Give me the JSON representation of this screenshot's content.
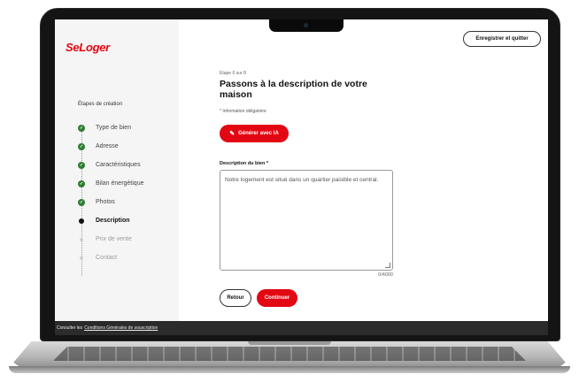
{
  "brand": {
    "logo": "SeLoger",
    "accent": "#e30613"
  },
  "header": {
    "save_label": "Enregistrer et quitter"
  },
  "sidebar": {
    "title": "Étapes de création",
    "steps": [
      {
        "label": "Type de bien",
        "state": "done"
      },
      {
        "label": "Adresse",
        "state": "done"
      },
      {
        "label": "Caractéristiques",
        "state": "done"
      },
      {
        "label": "Bilan énergétique",
        "state": "done"
      },
      {
        "label": "Photos",
        "state": "done"
      },
      {
        "label": "Description",
        "state": "current"
      },
      {
        "label": "Prix de vente",
        "state": "todo"
      },
      {
        "label": "Contact",
        "state": "todo"
      }
    ]
  },
  "main": {
    "step_count": "Étape 6 sur 8",
    "title": "Passons à la description de votre maison",
    "required_note": "* Information obligatoire",
    "ai_button": "Générer avec IA",
    "description_label": "Description du bien *",
    "description_value": "Notre logement est situé dans un quartier paisible et central.",
    "counter": "0/4000",
    "back_button": "Retour",
    "continue_button": "Continuer"
  },
  "footer": {
    "prefix": "Consulter les",
    "link": "Conditions Générales de souscription"
  }
}
